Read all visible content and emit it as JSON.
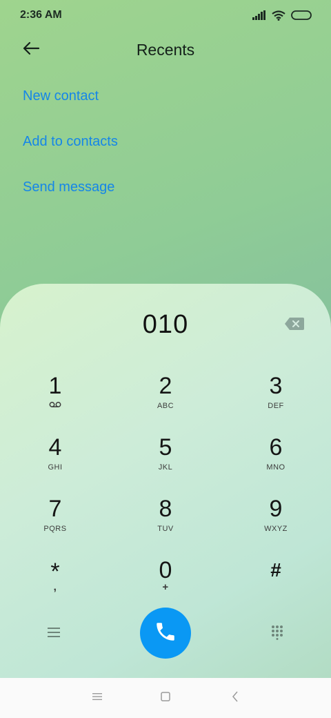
{
  "status_bar": {
    "time": "2:36 AM"
  },
  "header": {
    "title": "Recents"
  },
  "actions": {
    "new_contact": "New contact",
    "add_to_contacts": "Add to contacts",
    "send_message": "Send message"
  },
  "dialer": {
    "number": "010",
    "keys": [
      {
        "digit": "1",
        "letters": ""
      },
      {
        "digit": "2",
        "letters": "ABC"
      },
      {
        "digit": "3",
        "letters": "DEF"
      },
      {
        "digit": "4",
        "letters": "GHI"
      },
      {
        "digit": "5",
        "letters": "JKL"
      },
      {
        "digit": "6",
        "letters": "MNO"
      },
      {
        "digit": "7",
        "letters": "PQRS"
      },
      {
        "digit": "8",
        "letters": "TUV"
      },
      {
        "digit": "9",
        "letters": "WXYZ"
      },
      {
        "digit": "*",
        "letters": ","
      },
      {
        "digit": "0",
        "letters": "+"
      },
      {
        "digit": "#",
        "letters": ""
      }
    ]
  },
  "icons": {
    "back": "arrow-left-icon",
    "backspace": "backspace-icon",
    "voicemail": "voicemail-icon",
    "menu": "menu-icon",
    "call": "phone-icon",
    "dialpad": "dialpad-icon"
  },
  "colors": {
    "accent": "#1586e8",
    "call_button": "#0a98f4"
  }
}
